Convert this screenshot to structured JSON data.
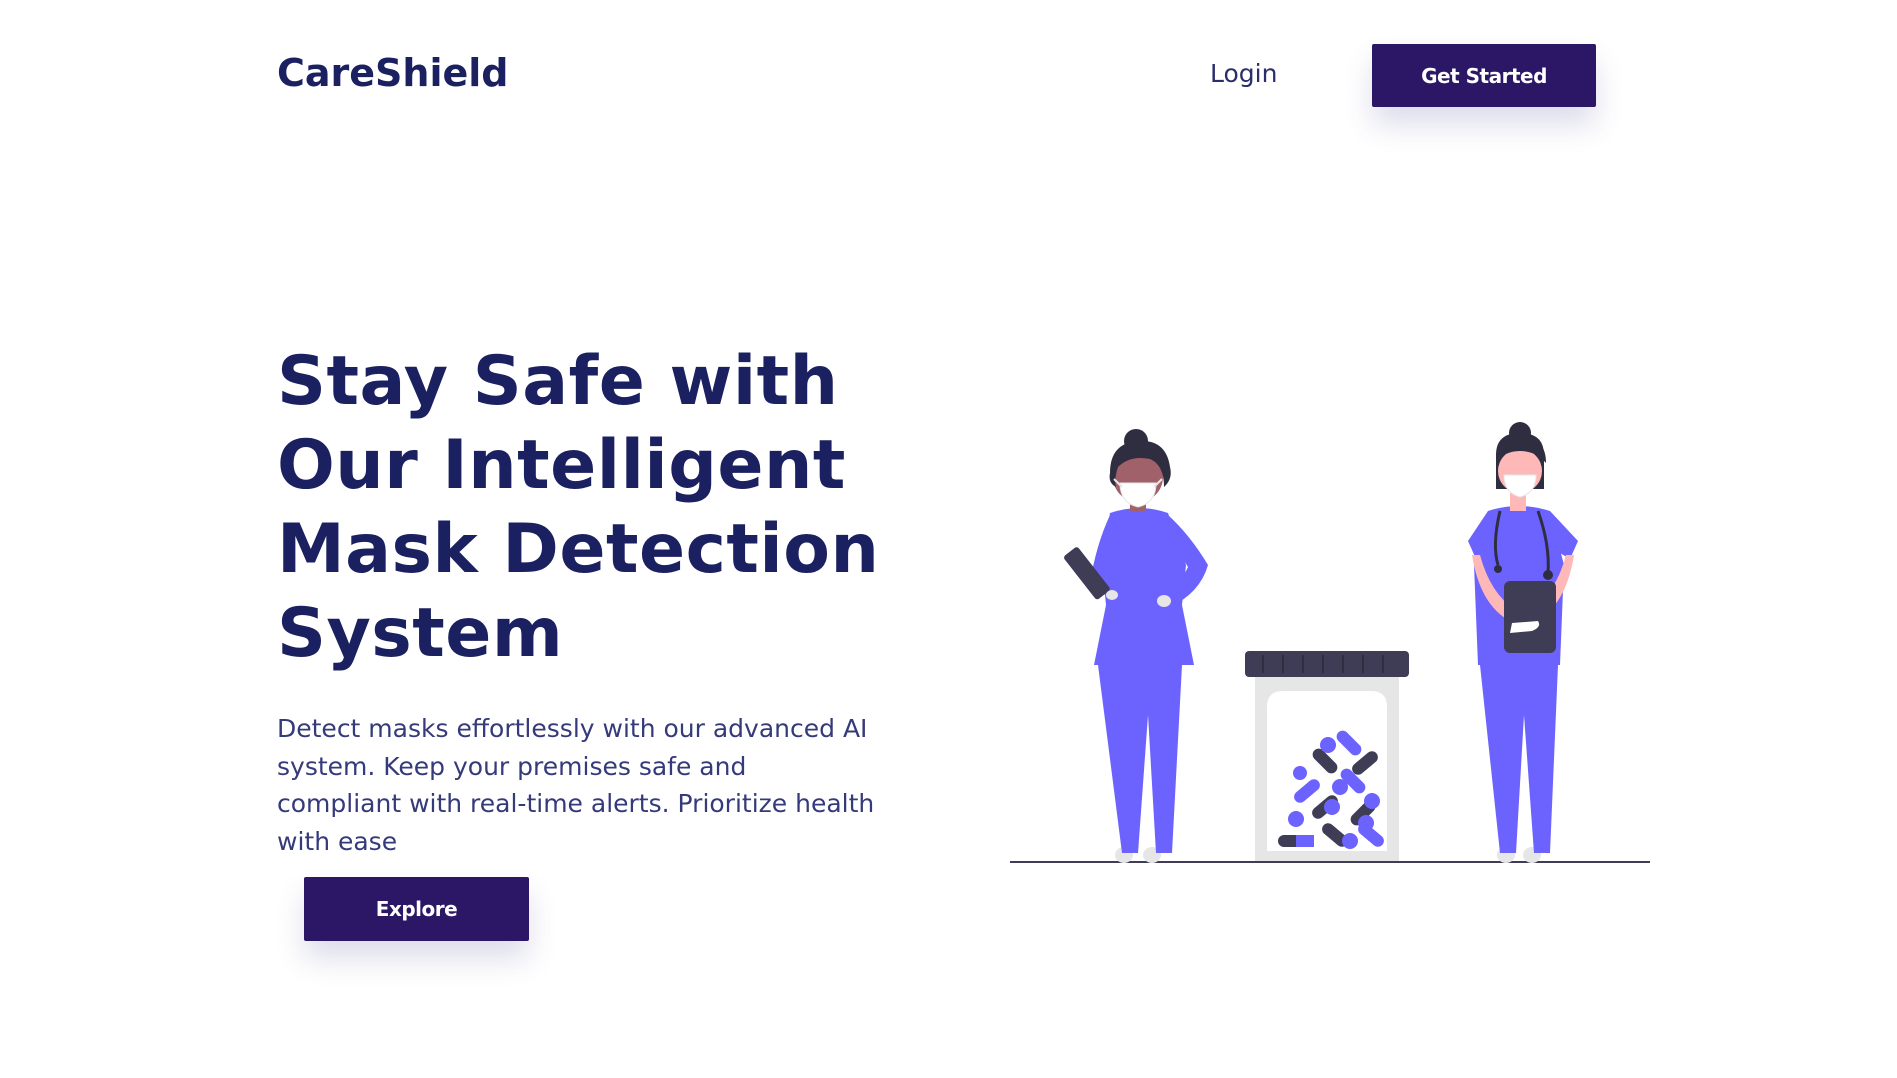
{
  "header": {
    "brand": "CareShield",
    "login_label": "Login",
    "get_started_label": "Get Started"
  },
  "hero": {
    "title": "Stay Safe with Our Intelligent Mask Detection System",
    "description": "Detect masks effortlessly with our advanced AI system. Keep your premises safe and compliant with real-time alerts. Prioritize health with ease",
    "explore_label": "Explore"
  },
  "illustration": {
    "icon": "medical-staff-illustration",
    "colors": {
      "scrubs": "#6c63ff",
      "dark": "#3f3d56",
      "skin_dark": "#a0616a",
      "skin_light": "#ffb8b8",
      "hair": "#2f2e41",
      "jar": "#e6e6e6"
    }
  },
  "theme": {
    "primary": "#2c1767",
    "heading": "#1b2160",
    "body_text": "#353a7a",
    "background": "#ffffff"
  }
}
